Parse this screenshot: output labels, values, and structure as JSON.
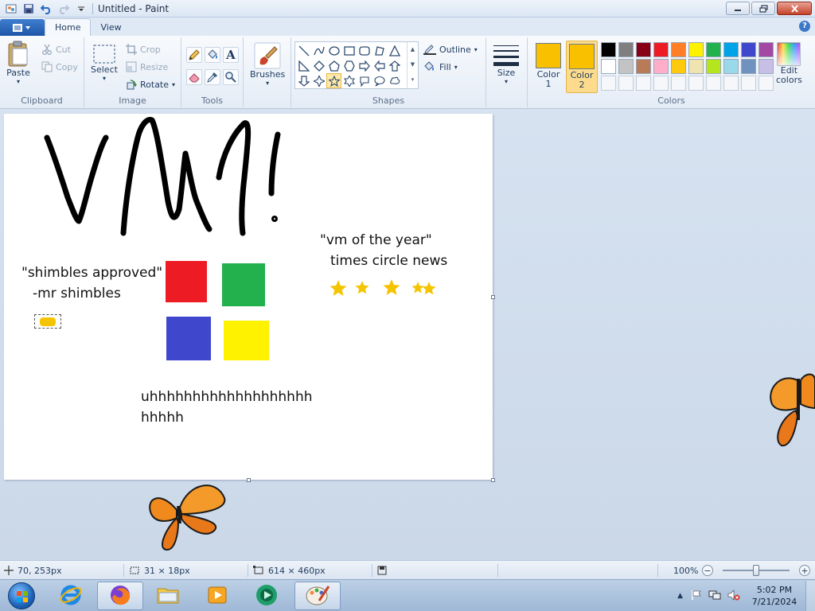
{
  "window": {
    "title": "Untitled - Paint"
  },
  "tabs": [
    {
      "label": "Home"
    },
    {
      "label": "View"
    }
  ],
  "ribbon": {
    "clipboard": {
      "label": "Clipboard",
      "paste": "Paste",
      "cut": "Cut",
      "copy": "Copy"
    },
    "image": {
      "label": "Image",
      "select": "Select",
      "crop": "Crop",
      "resize": "Resize",
      "rotate": "Rotate"
    },
    "tools": {
      "label": "Tools"
    },
    "brushes": {
      "label": "Brushes"
    },
    "shapes": {
      "label": "Shapes",
      "outline": "Outline",
      "fill": "Fill"
    },
    "size": {
      "label": "Size"
    },
    "colors": {
      "label": "Colors",
      "color1": "Color\n1",
      "color2": "Color\n2",
      "edit": "Edit\ncolors",
      "color1_value": "#f9c000",
      "color2_value": "#f9c000",
      "palette": [
        "#000000",
        "#7f7f7f",
        "#880015",
        "#ed1c24",
        "#ff7f27",
        "#fff200",
        "#22b14c",
        "#00a2e8",
        "#3f48cc",
        "#a349a4",
        "#ffffff",
        "#c3c3c3",
        "#b97a57",
        "#ffaec9",
        "#ffc90e",
        "#efe4b0",
        "#b5e61d",
        "#99d9ea",
        "#7092be",
        "#c8bfe7",
        "#f5f7fa",
        "#f5f7fa",
        "#f5f7fa",
        "#f5f7fa",
        "#f5f7fa",
        "#f5f7fa",
        "#f5f7fa",
        "#f5f7fa",
        "#f5f7fa",
        "#f5f7fa"
      ]
    }
  },
  "canvas": {
    "texts": {
      "vm_of_year": "\"vm of the year\"",
      "times_circle": "times circle news",
      "shimbles_quote": "\"shimbles approved\"",
      "mr_shimbles": "-mr shimbles",
      "uhh_line1": "uhhhhhhhhhhhhhhhhhhh",
      "uhh_line2": "hhhhh"
    },
    "squares": {
      "red": "#ed1c24",
      "green": "#22b14c",
      "blue": "#3f48cc",
      "yellow": "#fff200"
    },
    "star_color": "#f5c400",
    "stroke_color": "#000000"
  },
  "statusbar": {
    "cursor_pos": "70, 253px",
    "selection_size": "31 × 18px",
    "canvas_size": "614 × 460px",
    "zoom": "100%"
  },
  "taskbar": {
    "time": "5:02 PM",
    "date": "7/21/2024"
  }
}
